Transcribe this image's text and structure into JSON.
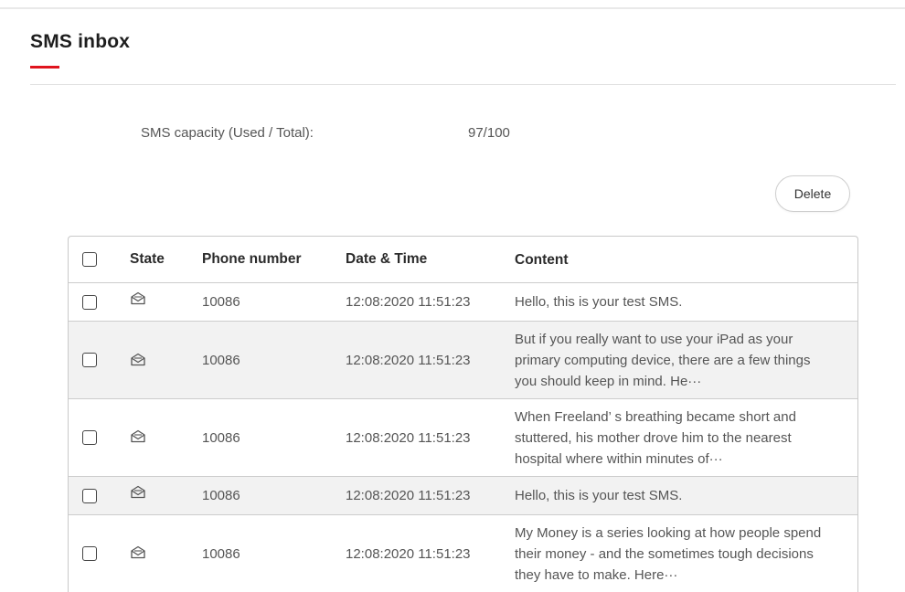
{
  "page": {
    "title": "SMS inbox"
  },
  "capacity": {
    "label": "SMS capacity (Used / Total):",
    "value": "97/100"
  },
  "toolbar": {
    "delete_label": "Delete"
  },
  "table": {
    "headers": {
      "state": "State",
      "phone": "Phone number",
      "datetime": "Date & Time",
      "content": "Content"
    },
    "rows": [
      {
        "state_icon": "envelope-open-icon",
        "phone": "10086",
        "datetime": "12:08:2020 11:51:23",
        "content": "Hello, this is your test SMS."
      },
      {
        "state_icon": "envelope-open-icon",
        "phone": "10086",
        "datetime": "12:08:2020 11:51:23",
        "content": "But if you really want to use your iPad as your primary computing device, there are a few things you should keep in mind. He···"
      },
      {
        "state_icon": "envelope-open-icon",
        "phone": "10086",
        "datetime": "12:08:2020 11:51:23",
        "content": "When Freeland’ s breathing became short and stuttered, his mother drove him to the nearest hospital where within minutes of···"
      },
      {
        "state_icon": "envelope-open-icon",
        "phone": "10086",
        "datetime": "12:08:2020 11:51:23",
        "content": "Hello, this is your test SMS."
      },
      {
        "state_icon": "envelope-open-icon",
        "phone": "10086",
        "datetime": "12:08:2020 11:51:23",
        "content": "My Money is a series looking at how people spend their money - and the sometimes tough decisions they have to make. Here···"
      }
    ]
  },
  "colors": {
    "accent": "#e0141e",
    "row_alt": "#f2f2f2",
    "border": "#cccccc"
  }
}
